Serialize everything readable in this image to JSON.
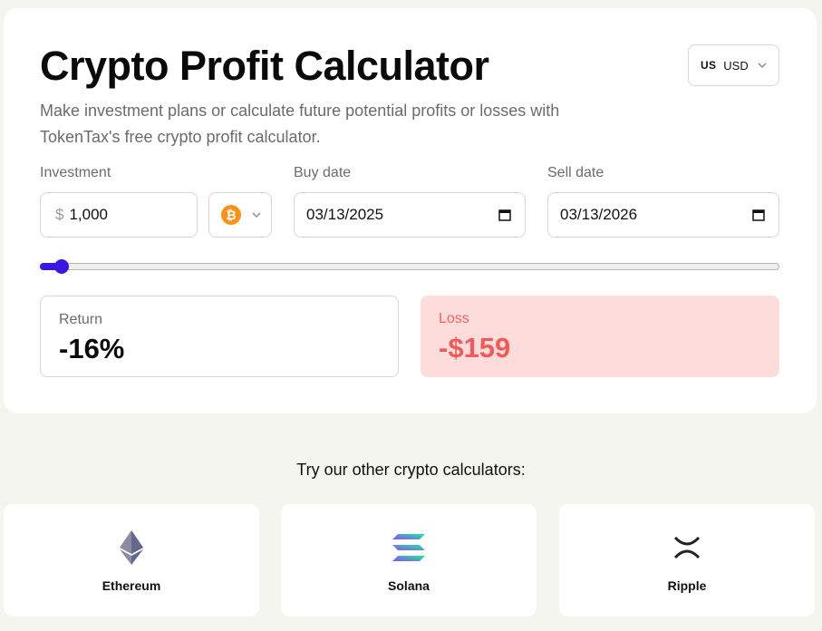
{
  "calculator": {
    "title": "Crypto Profit Calculator",
    "subtitle": "Make investment plans or calculate future potential profits or losses with TokenTax's free crypto profit calculator.",
    "currency": {
      "flag": "US",
      "code": "USD"
    },
    "investment": {
      "label": "Investment",
      "currency_symbol": "$",
      "value": "1,000"
    },
    "coin": {
      "icon": "bitcoin-icon",
      "glyph": "₿"
    },
    "buy_date": {
      "label": "Buy date",
      "value": "03/13/2025"
    },
    "sell_date": {
      "label": "Sell date",
      "value": "03/13/2026"
    },
    "slider": {
      "value_fraction": 0.02
    },
    "return": {
      "label": "Return",
      "value": "-16%"
    },
    "loss": {
      "label": "Loss",
      "value": "-$159"
    },
    "colors": {
      "accent": "#3d16e0",
      "loss_bg": "#ffdcdc",
      "loss_text": "#f15a5a",
      "bitcoin": "#f7931a"
    }
  },
  "other": {
    "heading": "Try our other crypto calculators:",
    "items": [
      {
        "name": "Ethereum",
        "icon": "ethereum-icon"
      },
      {
        "name": "Solana",
        "icon": "solana-icon"
      },
      {
        "name": "Ripple",
        "icon": "ripple-icon"
      }
    ]
  }
}
